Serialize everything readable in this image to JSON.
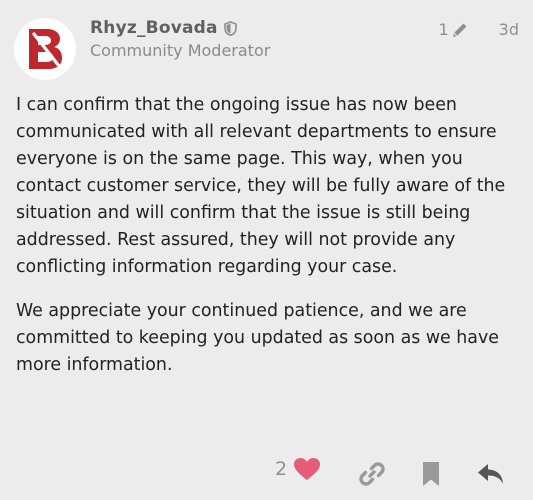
{
  "post": {
    "author": {
      "username": "Rhyz_Bovada",
      "role": "Community Moderator",
      "avatar_icon": "bovada-b-logo-icon",
      "badge_icon": "shield-icon"
    },
    "meta": {
      "edit_count": "1",
      "edit_icon": "pencil-icon",
      "age": "3d"
    },
    "paragraphs": [
      "I can confirm that the ongoing issue has now been communicated with all relevant departments to ensure everyone is on the same page. This way, when you contact customer service, they will be fully aware of the situation and will confirm that the issue is still being addressed. Rest assured, they will not provide any conflicting information regarding your case.",
      "We appreciate your continued patience, and we are committed to keeping you updated as soon as we have more information."
    ],
    "actions": {
      "like_count": "2",
      "like_icon": "heart-icon",
      "link_icon": "link-icon",
      "bookmark_icon": "bookmark-icon",
      "reply_icon": "reply-icon"
    }
  },
  "colors": {
    "background": "#ececec",
    "brand_red": "#c0282d",
    "heart": "#e45c7a",
    "muted": "#8f8f8f"
  }
}
